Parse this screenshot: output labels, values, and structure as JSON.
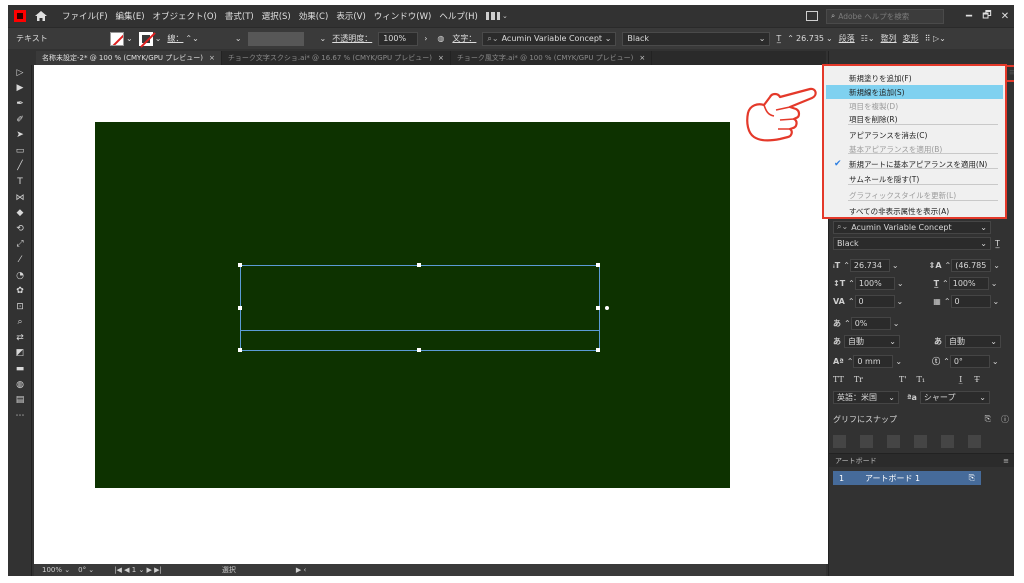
{
  "menubar": {
    "items": [
      "ファイル(F)",
      "編集(E)",
      "オブジェクト(O)",
      "書式(T)",
      "選択(S)",
      "効果(C)",
      "表示(V)",
      "ウィンドウ(W)",
      "ヘルプ(H)"
    ],
    "search_placeholder": "Adobe ヘルプを検索",
    "window_buttons": [
      "━",
      "🗗",
      "✕"
    ]
  },
  "controlbar": {
    "tool_label": "テキスト",
    "stroke_label": "線：",
    "opacity_label": "不透明度：",
    "opacity_value": "100%",
    "char_label": "文字：",
    "font_value": "Acumin Variable Concept",
    "style_value": "Black",
    "size_value": "26.735",
    "paragraph_label": "段落",
    "align_label": "整列",
    "transform_label": "変形"
  },
  "tabs": [
    {
      "label": "名称未設定-2* @ 100 % (CMYK/GPU プレビュー)",
      "close": "×"
    },
    {
      "label": "チョーク文字スクショ.ai* @ 16.67 % (CMYK/GPU プレビュー)",
      "close": "×"
    },
    {
      "label": "チョーク風文字.ai* @ 100 % (CMYK/GPU プレビュー)",
      "close": "×"
    }
  ],
  "tools": [
    "selection-tool",
    "direct-selection-tool",
    "pen-tool",
    "curvature-tool",
    "anchor-tool",
    "rectangle-tool",
    "brush-tool",
    "type-tool",
    "width-tool",
    "eraser-tool",
    "rotate-tool",
    "scale-tool",
    "eyedropper-tool",
    "blend-tool",
    "symbol-tool",
    "artboard-tool",
    "zoom-tool",
    "swap-colors-tool",
    "fill-stroke-tool",
    "color-mode-tool",
    "draw-mode-tool",
    "screen-mode-tool",
    "more-tools"
  ],
  "statusbar": {
    "zoom": "100%",
    "rotation": "0°",
    "artboard_nav": "1",
    "tool_status": "選択"
  },
  "flyout_menu": {
    "items": [
      {
        "label": "新規塗りを追加(F)",
        "state": "normal"
      },
      {
        "label": "新規線を追加(S)",
        "state": "highlight"
      },
      {
        "label": "項目を複製(D)",
        "state": "disabled"
      },
      {
        "label": "項目を削除(R)",
        "state": "normal"
      },
      {
        "label": "アピアランスを消去(C)",
        "state": "normal"
      },
      {
        "label": "基本アピアランスを適用(B)",
        "state": "disabled"
      },
      {
        "label": "新規アートに基本アピアランスを適用(N)",
        "state": "checked"
      },
      {
        "label": "サムネールを隠す(T)",
        "state": "normal"
      },
      {
        "label": "グラフィックスタイルを更新(L)",
        "state": "disabled"
      },
      {
        "label": "すべての非表示属性を表示(A)",
        "state": "normal"
      }
    ]
  },
  "character_panel": {
    "font": "Acumin Variable Concept",
    "style": "Black",
    "font_size": "26.734",
    "leading": "(46.785",
    "vertical_scale": "100%",
    "horizontal_scale": "100%",
    "kerning": "0",
    "tracking": "0",
    "tsume": "0%",
    "aki_left": "自動",
    "aki_right": "自動",
    "baseline_shift": "0 mm",
    "rotation": "0°",
    "caps_label": "TT",
    "small_caps_label": "Tr",
    "superscript_label": "T'",
    "subscript_label": "T₁",
    "language": "英語：米国",
    "antialias": "シャープ",
    "snap_label": "グリフにスナップ"
  },
  "artboards_panel": {
    "title": "アートボード",
    "items": [
      {
        "number": "1",
        "name": "アートボード 1"
      }
    ]
  },
  "colors": {
    "artboard_bg": "#0d3200",
    "selection_blue": "#5b9bd5",
    "highlight": "#7fd1f0",
    "callout_red": "#e4392a"
  }
}
